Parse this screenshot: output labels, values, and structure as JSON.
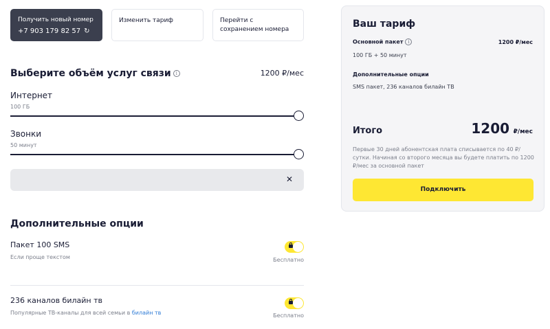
{
  "top_options": {
    "new_number": {
      "label": "Получить новый номер",
      "phone": "+7 903 179 82 57"
    },
    "change_tariff": {
      "label": "Изменить тариф"
    },
    "keep_number": {
      "label": "Перейти с сохранением номера"
    }
  },
  "volume": {
    "title": "Выберите объём услуг связи",
    "price": "1200 ₽/мес",
    "internet": {
      "label": "Интернет",
      "value": "100 ГБ",
      "level": 1.0
    },
    "calls": {
      "label": "Звонки",
      "value": "50 минут",
      "level": 1.0
    }
  },
  "options": {
    "title": "Дополнительные опции",
    "items": [
      {
        "name": "Пакет 100 SMS",
        "desc": "Если проще текстом",
        "price": "Бесплатно",
        "enabled": true
      },
      {
        "name": "236 каналов билайн тв",
        "desc": "Популярные ТВ-каналы для всей семьи в",
        "desc_link": "билайн тв",
        "price": "Бесплатно",
        "enabled": true
      }
    ]
  },
  "summary": {
    "title": "Ваш тариф",
    "base_label": "Основной пакет",
    "base_price": "1200 ₽/мес",
    "base_details": "100 ГБ  +  50 минут",
    "extra_label": "Дополнительные опции",
    "extra_details": "SMS пакет, 236 каналов билайн ТВ",
    "total_label": "Итого",
    "total_value": "1200",
    "total_unit": "₽/мес",
    "note": "Первые 30 дней абонентская плата списывается по 40 ₽/сутки. Начиная со второго месяца вы будете платить по 1200 ₽/мес за основной пакет",
    "connect_label": "Подключить"
  },
  "colors": {
    "accent": "#fee733",
    "dark": "#3b3f4e",
    "link": "#2e7bd6"
  }
}
